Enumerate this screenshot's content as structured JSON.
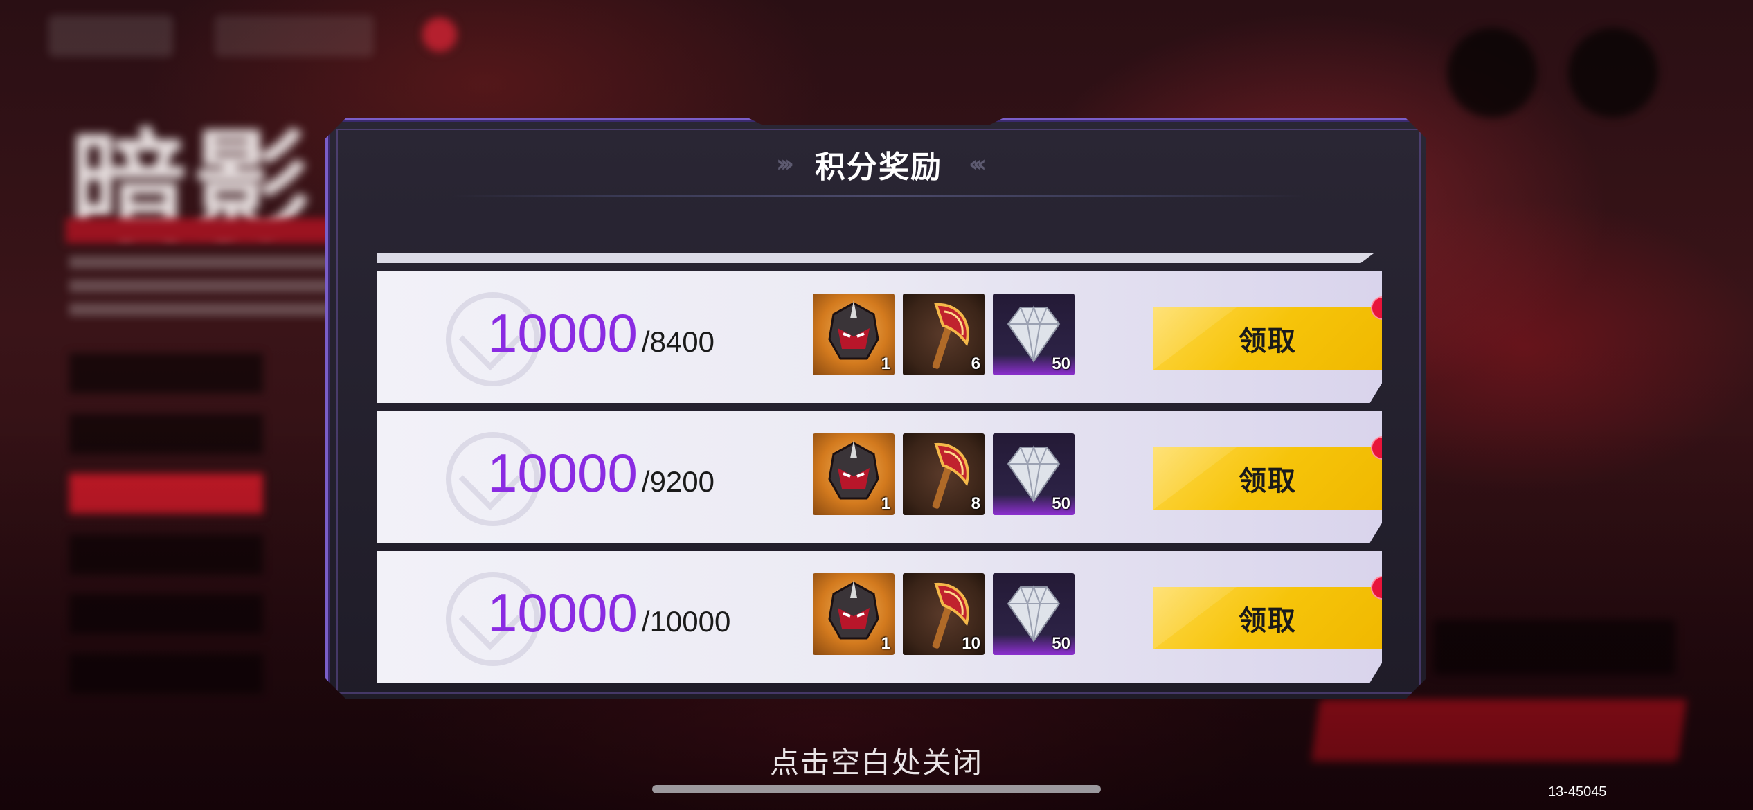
{
  "modal": {
    "title": "积分奖励",
    "rows": [
      {
        "target": "10000",
        "current": "/8400",
        "rewards": [
          {
            "icon": "helmet-icon",
            "qty": "1"
          },
          {
            "icon": "axe-icon",
            "qty": "6"
          },
          {
            "icon": "diamond-icon",
            "qty": "50"
          }
        ],
        "claim_label": "领取",
        "has_notification": true
      },
      {
        "target": "10000",
        "current": "/9200",
        "rewards": [
          {
            "icon": "helmet-icon",
            "qty": "1"
          },
          {
            "icon": "axe-icon",
            "qty": "8"
          },
          {
            "icon": "diamond-icon",
            "qty": "50"
          }
        ],
        "claim_label": "领取",
        "has_notification": true
      },
      {
        "target": "10000",
        "current": "/10000",
        "rewards": [
          {
            "icon": "helmet-icon",
            "qty": "1"
          },
          {
            "icon": "axe-icon",
            "qty": "10"
          },
          {
            "icon": "diamond-icon",
            "qty": "50"
          }
        ],
        "claim_label": "领取",
        "has_notification": true
      }
    ]
  },
  "close_hint": "点击空白处关闭",
  "version": "13-45045",
  "colors": {
    "target_purple": "#8a2be2",
    "claim_yellow": "#f6c40a",
    "notify_red": "#e8143a",
    "modal_border": "#7a5ec8"
  }
}
